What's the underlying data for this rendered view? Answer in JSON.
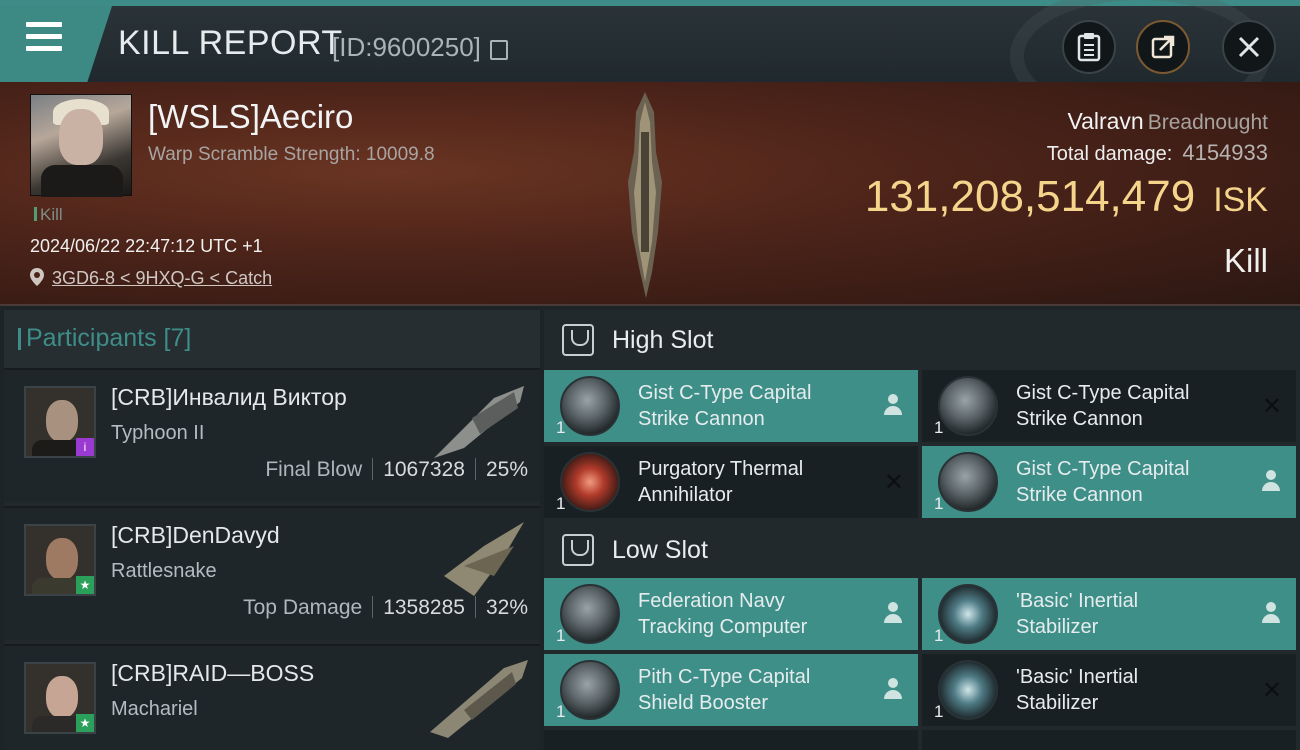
{
  "header": {
    "title": "KILL REPORT",
    "report_id": "[ID:9600250]",
    "icons": {
      "menu": "menu-icon",
      "copy": "copy-icon",
      "clipboard": "clipboard-icon",
      "share": "share-icon",
      "close": "close-icon"
    }
  },
  "victim": {
    "name": "[WSLS]Aeciro",
    "scramble": "Warp Scramble Strength: 10009.8",
    "kill_tag": "Kill",
    "timestamp": "2024/06/22 22:47:12 UTC +1",
    "location": "3GD6-8 < 9HXQ-G < Catch",
    "ship_name": "Valravn",
    "ship_class": "Breadnought",
    "total_damage_label": "Total damage:",
    "total_damage": "4154933",
    "isk_value": "131,208,514,479",
    "isk_currency": "ISK",
    "result": "Kill"
  },
  "participants": {
    "title": "Participants [7]",
    "rows": [
      {
        "name": "[CRB]Инвалид Виктор",
        "ship": "Typhoon II",
        "role": "Final Blow",
        "damage": "1067328",
        "percent": "25%",
        "badge": "i",
        "badge_color": "#9b3ad0"
      },
      {
        "name": "[CRB]DenDavyd",
        "ship": "Rattlesnake",
        "role": "Top Damage",
        "damage": "1358285",
        "percent": "32%",
        "badge": "★",
        "badge_color": "#2aa05a"
      },
      {
        "name": "[CRB]RAID—BOSS",
        "ship": "Machariel",
        "badge": "★",
        "badge_color": "#2aa05a"
      }
    ]
  },
  "slots": {
    "high": {
      "label": "High Slot",
      "modules": [
        {
          "line1": "Gist C-Type Capital",
          "line2": "Strike Cannon",
          "qty": "1",
          "status": "dropped"
        },
        {
          "line1": "Gist C-Type Capital",
          "line2": "Strike Cannon",
          "qty": "1",
          "status": "destroyed"
        },
        {
          "line1": "Purgatory Thermal",
          "line2": "Annihilator",
          "qty": "1",
          "status": "destroyed"
        },
        {
          "line1": "Gist C-Type Capital",
          "line2": "Strike Cannon",
          "qty": "1",
          "status": "dropped"
        }
      ]
    },
    "low": {
      "label": "Low Slot",
      "modules": [
        {
          "line1": "Federation Navy",
          "line2": "Tracking Computer",
          "qty": "1",
          "status": "dropped"
        },
        {
          "line1": "'Basic' Inertial",
          "line2": "Stabilizer",
          "qty": "1",
          "status": "dropped"
        },
        {
          "line1": "Pith C-Type Capital",
          "line2": "Shield Booster",
          "qty": "1",
          "status": "dropped"
        },
        {
          "line1": "'Basic' Inertial",
          "line2": "Stabilizer",
          "qty": "1",
          "status": "destroyed"
        }
      ]
    }
  },
  "colors": {
    "accent": "#3e8d89",
    "isk": "#f5d48c",
    "module_active": "#3f8f89"
  }
}
